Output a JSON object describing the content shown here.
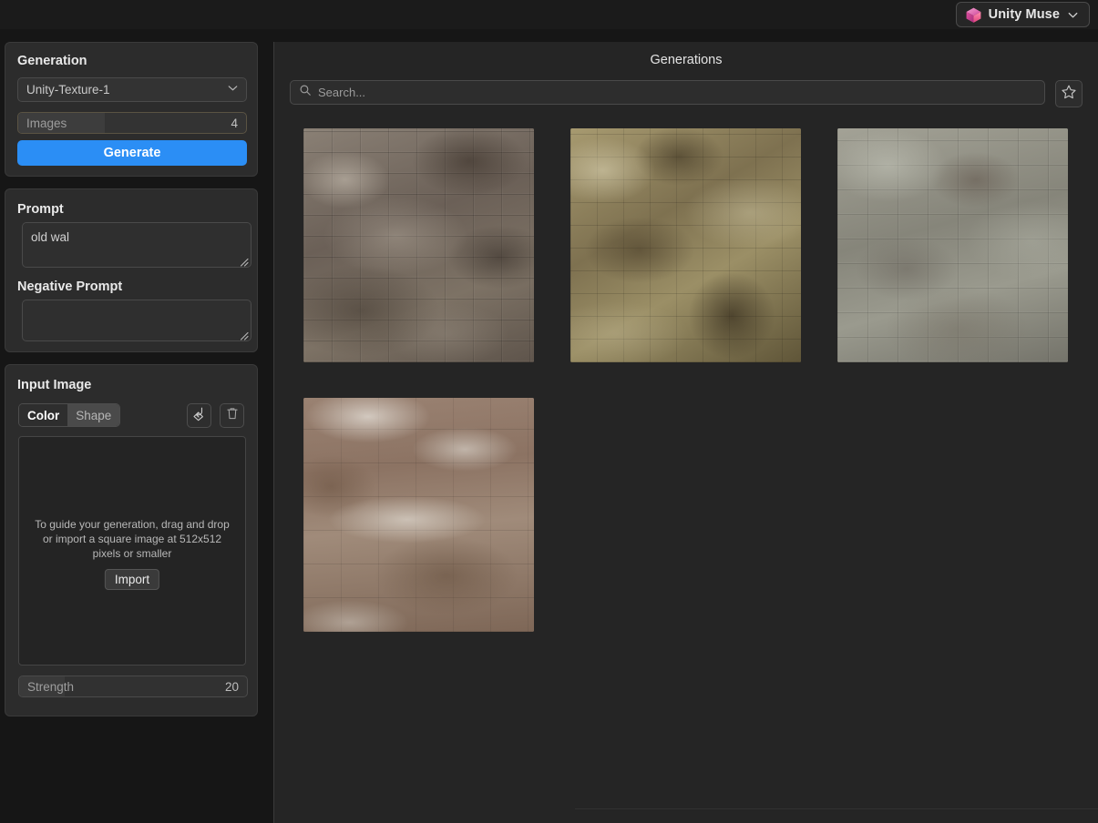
{
  "topbar": {
    "muse_label": "Unity Muse",
    "cube_icon": "unity-muse-cube-icon",
    "chevron_icon": "chevron-down-icon",
    "pill_border": "#4a4a4a"
  },
  "generation_panel": {
    "title": "Generation",
    "model": {
      "value": "Unity-Texture-1",
      "chevron_icon": "chevron-down-icon"
    },
    "images": {
      "label": "Images",
      "value": "4"
    },
    "generate_label": "Generate",
    "accent_color": "#2b8ef5"
  },
  "prompt_panel": {
    "prompt_title": "Prompt",
    "prompt_value": "old wal",
    "prompt_placeholder": "",
    "negative_title": "Negative Prompt",
    "negative_value": "",
    "negative_placeholder": "",
    "resize_icon": "resize-grip-icon"
  },
  "input_image_panel": {
    "title": "Input Image",
    "tabs": [
      {
        "label": "Color",
        "selected": true
      },
      {
        "label": "Shape",
        "selected": false
      }
    ],
    "fill_tool_icon": "paint-bucket-icon",
    "delete_icon": "trash-icon",
    "dropzone_text": "To guide your generation, drag and drop or import a square image at 512x512 pixels or smaller",
    "import_label": "Import",
    "strength": {
      "label": "Strength",
      "value": "20"
    }
  },
  "generations_panel": {
    "title": "Generations",
    "search": {
      "placeholder": "Search...",
      "value": "",
      "icon": "search-icon"
    },
    "favorites_icon": "star-icon",
    "results": [
      {
        "name": "generation-thumbnail-1",
        "style": "tex-a",
        "alt": "brown-gray brick wall texture"
      },
      {
        "name": "generation-thumbnail-2",
        "style": "tex-b",
        "alt": "olive khaki weathered wall texture"
      },
      {
        "name": "generation-thumbnail-3",
        "style": "tex-c",
        "alt": "gray concrete wall texture"
      },
      {
        "name": "generation-thumbnail-4",
        "style": "tex-d",
        "alt": "brown whitewashed plaster wall texture"
      }
    ]
  }
}
